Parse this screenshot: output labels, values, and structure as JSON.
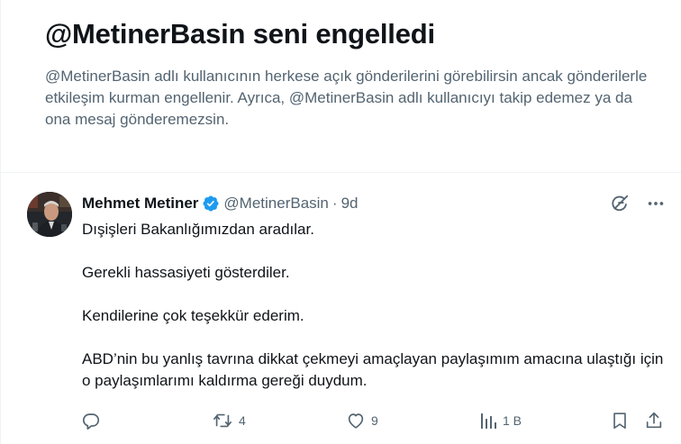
{
  "block_notice": {
    "title": "@MetinerBasin seni engelledi",
    "description": "@MetinerBasin adlı kullanıcının herkese açık gönderilerini görebilirsin ancak gönderilerle etkileşim kurman engellenir. Ayrıca, @MetinerBasin adlı kullanıcıyı takip edemez ya da ona mesaj gönderemezsin."
  },
  "tweet": {
    "author_name": "Mehmet Metiner",
    "handle": "@MetinerBasin",
    "separator": "·",
    "time": "9d",
    "paragraphs": [
      "Dışişleri Bakanlığımızdan aradılar.",
      "Gerekli hassasiyeti gösterdiler.",
      "Kendilerine çok teşekkür ederim.",
      "ABD’nin bu yanlış tavrına dikkat çekmeyi amaçlayan paylaşımım amacına ulaştığı için o paylaşımlarımı kaldırma gereği duydum."
    ],
    "actions": {
      "reply_count": "",
      "retweet_count": "4",
      "like_count": "9",
      "views_count": "1 B"
    }
  },
  "colors": {
    "text_primary": "#0f1419",
    "text_secondary": "#536471",
    "verified_blue": "#1d9bf0",
    "border": "#eff3f4"
  },
  "icons": {
    "header": [
      "grok-icon",
      "more-icon"
    ],
    "actions": [
      "reply-icon",
      "retweet-icon",
      "like-icon",
      "views-icon",
      "bookmark-icon",
      "share-icon"
    ]
  }
}
